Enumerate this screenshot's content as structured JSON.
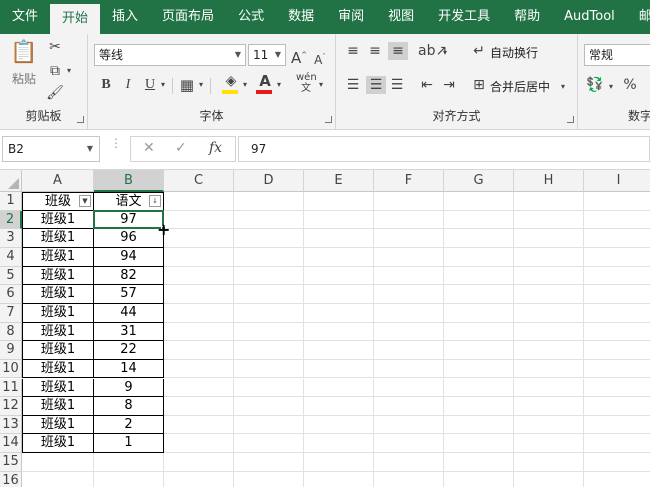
{
  "menu": {
    "tabs": [
      "文件",
      "开始",
      "插入",
      "页面布局",
      "公式",
      "数据",
      "审阅",
      "视图",
      "开发工具",
      "帮助",
      "AudTool",
      "邮件"
    ],
    "active_index": 1
  },
  "ribbon": {
    "clipboard": {
      "paste_label": "粘贴",
      "group_label": "剪贴板"
    },
    "font": {
      "font_name": "等线",
      "font_size": "11",
      "bold": "B",
      "italic": "I",
      "underline": "U",
      "grow": "A",
      "shrink": "A",
      "group_label": "字体",
      "fill_color": "#ffe100",
      "font_color": "#e41c1c"
    },
    "alignment": {
      "wrap_text": "自动换行",
      "merge_center": "合并后居中",
      "group_label": "对齐方式"
    },
    "number": {
      "format": "常规",
      "percent": "%",
      "group_label": "数字"
    }
  },
  "formula_bar": {
    "name_box": "B2",
    "cancel": "✕",
    "enter": "✓",
    "fx": "fx",
    "value": "97"
  },
  "sheet": {
    "columns": [
      "A",
      "B",
      "C",
      "D",
      "E",
      "F",
      "G",
      "H",
      "I"
    ],
    "rows": [
      "1",
      "2",
      "3",
      "4",
      "5",
      "6",
      "7",
      "8",
      "9",
      "10",
      "11",
      "12",
      "13",
      "14",
      "15",
      "16"
    ],
    "header": {
      "a": "班级",
      "b": "语文"
    },
    "data": [
      {
        "a": "班级1",
        "b": "97"
      },
      {
        "a": "班级1",
        "b": "96"
      },
      {
        "a": "班级1",
        "b": "94"
      },
      {
        "a": "班级1",
        "b": "82"
      },
      {
        "a": "班级1",
        "b": "57"
      },
      {
        "a": "班级1",
        "b": "44"
      },
      {
        "a": "班级1",
        "b": "31"
      },
      {
        "a": "班级1",
        "b": "22"
      },
      {
        "a": "班级1",
        "b": "14"
      },
      {
        "a": "班级1",
        "b": "9"
      },
      {
        "a": "班级1",
        "b": "8"
      },
      {
        "a": "班级1",
        "b": "2"
      },
      {
        "a": "班级1",
        "b": "1"
      }
    ],
    "selected_cell": "B2",
    "accent": "#217346"
  }
}
